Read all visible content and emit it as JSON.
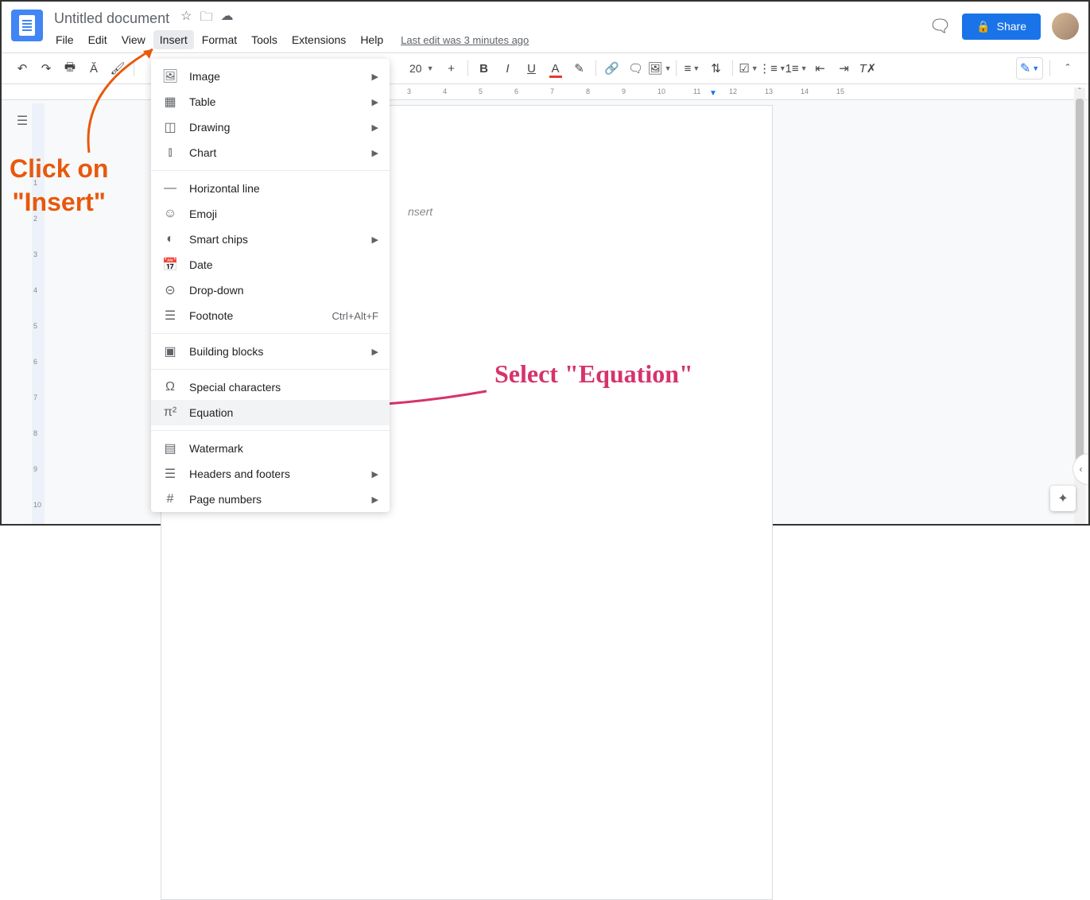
{
  "header": {
    "doc_title": "Untitled document",
    "last_edit": "Last edit was 3 minutes ago",
    "share_label": "Share"
  },
  "menus": [
    "File",
    "Edit",
    "View",
    "Insert",
    "Format",
    "Tools",
    "Extensions",
    "Help"
  ],
  "active_menu": "Insert",
  "dropdown": {
    "groups": [
      [
        {
          "icon": "🖼",
          "label": "Image",
          "arrow": true
        },
        {
          "icon": "▦",
          "label": "Table",
          "arrow": true
        },
        {
          "icon": "◫",
          "label": "Drawing",
          "arrow": true
        },
        {
          "icon": "⫾",
          "label": "Chart",
          "arrow": true
        }
      ],
      [
        {
          "icon": "—",
          "label": "Horizontal line"
        },
        {
          "icon": "☺",
          "label": "Emoji"
        },
        {
          "icon": "◐",
          "label": "Smart chips",
          "arrow": true
        },
        {
          "icon": "📅",
          "label": "Date"
        },
        {
          "icon": "⊝",
          "label": "Drop-down"
        },
        {
          "icon": "☰",
          "label": "Footnote",
          "shortcut": "Ctrl+Alt+F"
        }
      ],
      [
        {
          "icon": "▣",
          "label": "Building blocks",
          "arrow": true
        }
      ],
      [
        {
          "icon": "Ω",
          "label": "Special characters"
        },
        {
          "icon": "π²",
          "label": "Equation",
          "hover": true
        }
      ],
      [
        {
          "icon": "▤",
          "label": "Watermark"
        },
        {
          "icon": "☰",
          "label": "Headers and footers",
          "arrow": true
        },
        {
          "icon": "#",
          "label": "Page numbers",
          "arrow": true
        }
      ]
    ]
  },
  "toolbar": {
    "zoom": "20",
    "font_color_underline": "A"
  },
  "ruler_h": [
    3,
    4,
    5,
    6,
    7,
    8,
    9,
    10,
    11,
    12,
    13,
    14,
    15
  ],
  "ruler_v": [
    1,
    2,
    3,
    4,
    5,
    6,
    7,
    8,
    9,
    10
  ],
  "page_hint": "nsert",
  "annotations": {
    "a1_line1": "Click on",
    "a1_line2": "\"Insert\"",
    "a2": "Select \"Equation\""
  }
}
